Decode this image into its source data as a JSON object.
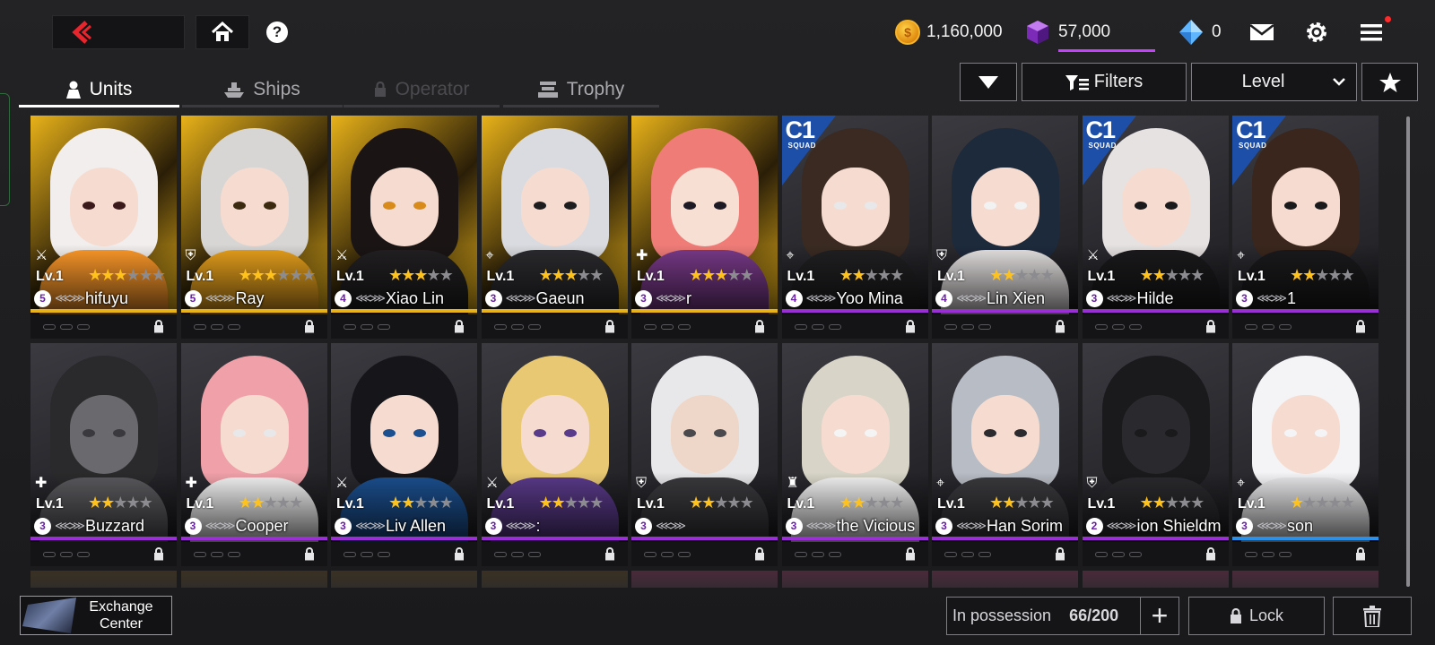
{
  "header": {
    "gold_amount": "1,160,000",
    "cube_amount": "57,000",
    "gem_amount": "0"
  },
  "tabs": [
    {
      "label": "Units",
      "state": "active"
    },
    {
      "label": "Ships",
      "state": "normal"
    },
    {
      "label": "Operator",
      "state": "locked"
    },
    {
      "label": "Trophy",
      "state": "normal"
    }
  ],
  "controls": {
    "filters_label": "Filters",
    "sort_label": "Level"
  },
  "units": [
    {
      "name": "hifuyu",
      "level": "Lv.1",
      "rank": "5",
      "stars": 3,
      "max_stars": 6,
      "rarity": "gold",
      "class_icon": "striker",
      "squad": false,
      "palette": [
        "#f2eeee",
        "#ff9a2a",
        "#f6dcd0",
        "#3a1a1a"
      ]
    },
    {
      "name": "Ray",
      "level": "Lv.1",
      "rank": "5",
      "stars": 3,
      "max_stars": 6,
      "rarity": "gold",
      "class_icon": "defender",
      "squad": false,
      "palette": [
        "#d8d6d4",
        "#e9a21c",
        "#f6dcd0",
        "#3b2a10"
      ]
    },
    {
      "name": "Xiao Lin",
      "level": "Lv.1",
      "rank": "4",
      "stars": 3,
      "max_stars": 5,
      "rarity": "gold",
      "class_icon": "striker",
      "squad": false,
      "palette": [
        "#1a1514",
        "#222022",
        "#f6dcd0",
        "#d88a1a"
      ]
    },
    {
      "name": "Gaeun",
      "level": "Lv.1",
      "rank": "3",
      "stars": 3,
      "max_stars": 5,
      "rarity": "gold",
      "class_icon": "ranger",
      "squad": false,
      "palette": [
        "#d9dbe0",
        "#2b2b2f",
        "#f6dcd0",
        "#1d1d20"
      ]
    },
    {
      "name": "r",
      "level": "Lv.1",
      "rank": "3",
      "stars": 3,
      "max_stars": 5,
      "rarity": "gold",
      "class_icon": "supporter",
      "squad": false,
      "palette": [
        "#f07c78",
        "#7a3a8a",
        "#f8dfd4",
        "#1d1a26"
      ]
    },
    {
      "name": "Yoo Mina",
      "level": "Lv.1",
      "rank": "4",
      "stars": 2,
      "max_stars": 5,
      "rarity": "purple",
      "class_icon": "ranger",
      "squad": true,
      "palette": [
        "#3a2a22",
        "#202022",
        "#f6dcd0",
        "#e8e8ea"
      ]
    },
    {
      "name": "Lin Xien",
      "level": "Lv.1",
      "rank": "4",
      "stars": 2,
      "max_stars": 5,
      "rarity": "purple",
      "class_icon": "defender",
      "squad": false,
      "palette": [
        "#1d2a3c",
        "#e8e4e4",
        "#f6dcd0",
        "#f2f2f2"
      ]
    },
    {
      "name": "Hilde",
      "level": "Lv.1",
      "rank": "3",
      "stars": 2,
      "max_stars": 5,
      "rarity": "purple",
      "class_icon": "striker",
      "squad": true,
      "palette": [
        "#e6e2e2",
        "#1a1a1c",
        "#f6dcd0",
        "#1a1a1c"
      ]
    },
    {
      "name": "1",
      "level": "Lv.1",
      "rank": "3",
      "stars": 2,
      "max_stars": 5,
      "rarity": "purple",
      "class_icon": "ranger",
      "squad": true,
      "palette": [
        "#3a261c",
        "#1a1a1c",
        "#f6dcd0",
        "#1a1a1c"
      ]
    },
    {
      "name": "Buzzard",
      "level": "Lv.1",
      "rank": "3",
      "stars": 2,
      "max_stars": 5,
      "rarity": "purple",
      "class_icon": "supporter",
      "squad": false,
      "palette": [
        "#2a2a2c",
        "#5a5a5e",
        "#6a6a6e",
        "#3a3a3e"
      ]
    },
    {
      "name": "Cooper",
      "level": "Lv.1",
      "rank": "3",
      "stars": 2,
      "max_stars": 5,
      "rarity": "purple",
      "class_icon": "supporter",
      "squad": false,
      "palette": [
        "#f0a0a8",
        "#f4f4f4",
        "#f6dcd0",
        "#e8e8ea"
      ]
    },
    {
      "name": "Liv Allen",
      "level": "Lv.1",
      "rank": "3",
      "stars": 2,
      "max_stars": 5,
      "rarity": "purple",
      "class_icon": "striker",
      "squad": false,
      "palette": [
        "#16161a",
        "#1b4f8f",
        "#f6dcd0",
        "#1b4f8f"
      ]
    },
    {
      "name": ":",
      "level": "Lv.1",
      "rank": "3",
      "stars": 2,
      "max_stars": 5,
      "rarity": "purple",
      "class_icon": "striker",
      "squad": false,
      "palette": [
        "#e8c872",
        "#5a3a8a",
        "#f6dcd0",
        "#5a3a8a"
      ]
    },
    {
      "name": "",
      "level": "Lv.1",
      "rank": "3",
      "stars": 2,
      "max_stars": 5,
      "rarity": "purple",
      "class_icon": "defender",
      "squad": false,
      "palette": [
        "#e8e8ea",
        "#3a3a3e",
        "#eed6c8",
        "#4a4a4e"
      ]
    },
    {
      "name": "the Vicious",
      "level": "Lv.1",
      "rank": "3",
      "stars": 2,
      "max_stars": 5,
      "rarity": "purple",
      "class_icon": "tower",
      "squad": false,
      "palette": [
        "#d8d4c8",
        "#f4f4f4",
        "#f6dcd0",
        "#f4f4f4"
      ]
    },
    {
      "name": "Han Sorim",
      "level": "Lv.1",
      "rank": "3",
      "stars": 2,
      "max_stars": 5,
      "rarity": "purple",
      "class_icon": "ranger",
      "squad": false,
      "palette": [
        "#b8bcc4",
        "#3a3a3e",
        "#f6dcd0",
        "#2b2b2f"
      ]
    },
    {
      "name": "ion Shieldm",
      "level": "Lv.1",
      "rank": "2",
      "stars": 2,
      "max_stars": 5,
      "rarity": "purple",
      "class_icon": "defender",
      "squad": false,
      "palette": [
        "#1a1a1c",
        "#2a2a2e",
        "#2a2a2e",
        "#1a1a1c"
      ]
    },
    {
      "name": "son",
      "level": "Lv.1",
      "rank": "3",
      "stars": 1,
      "max_stars": 5,
      "rarity": "blue",
      "class_icon": "ranger",
      "squad": false,
      "palette": [
        "#f4f4f6",
        "#e8e8ea",
        "#f6dcd0",
        "#f4f4f6"
      ]
    }
  ],
  "footer": {
    "exchange_label_1": "Exchange",
    "exchange_label_2": "Center",
    "possession_label": "In possession",
    "possession_count": "66/200",
    "lock_label": "Lock"
  },
  "colors": {
    "gold_rarity": "#e8b21a",
    "purple_rarity": "#9b2fd6",
    "blue_rarity": "#2c8fe8",
    "squad_badge": "#1e4fa8",
    "cube_bar": "#c640ff"
  }
}
